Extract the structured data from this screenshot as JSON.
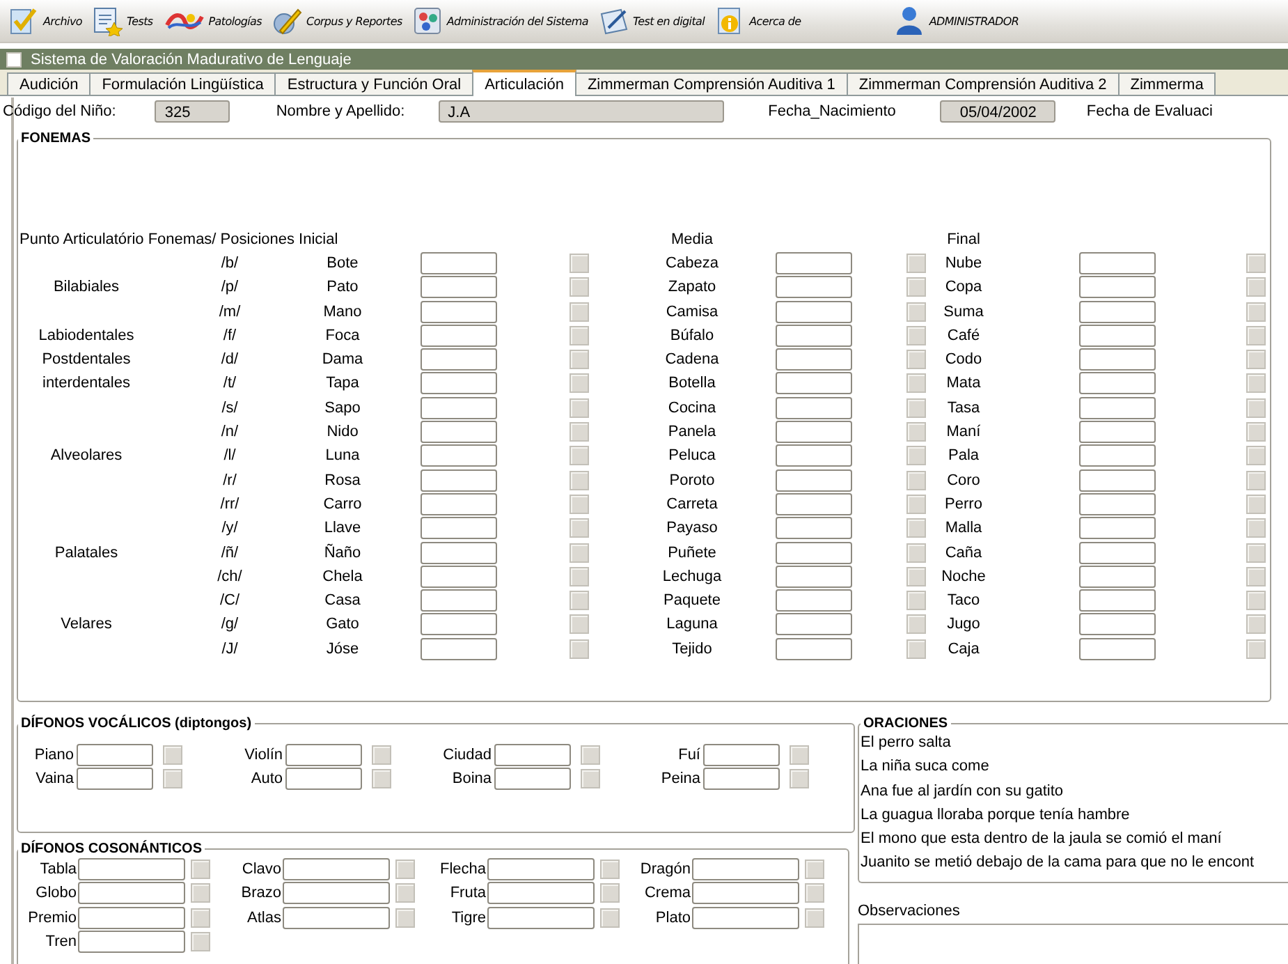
{
  "toolbar": [
    {
      "label": "Archivo",
      "kind": "check"
    },
    {
      "label": "Tests",
      "kind": "doc"
    },
    {
      "label": "Patologías",
      "kind": "paint"
    },
    {
      "label": "Corpus y Reportes",
      "kind": "pencil"
    },
    {
      "label": "Administración del Sistema",
      "kind": "admin"
    },
    {
      "label": "Test en digital",
      "kind": "digital"
    },
    {
      "label": "Acerca de",
      "kind": "info"
    },
    {
      "label": "ADMINISTRADOR",
      "kind": "user"
    }
  ],
  "window": {
    "title": "Sistema de  Valoración Madurativo de Lenguaje"
  },
  "tabs": [
    {
      "label": "Audición",
      "selected": false
    },
    {
      "label": "Formulación Lingüística",
      "selected": false
    },
    {
      "label": "Estructura y Función Oral",
      "selected": false
    },
    {
      "label": "Articulación",
      "selected": true
    },
    {
      "label": "Zimmerman Comprensión Auditiva 1",
      "selected": false
    },
    {
      "label": "Zimmerman Comprensión Auditiva 2",
      "selected": false
    },
    {
      "label": "Zimmerma",
      "selected": false
    }
  ],
  "info": [
    {
      "label": "Código del Niño:",
      "value": "325"
    },
    {
      "label": "Nombre y Apellido:",
      "value": "J.A"
    },
    {
      "label": "Fecha_Nacimiento",
      "value": "05/04/2002"
    },
    {
      "label": "Fecha de Evaluaci"
    }
  ],
  "fonemas": {
    "title": "FONEMAS",
    "header": "Punto Articulatório Fonemas/ Posiciones Inicial",
    "media_header": "Media",
    "final_header": "Final",
    "rows": [
      {
        "fonema": "/b/",
        "inicial": {
          "word": "Bote",
          "checked": false
        },
        "media": {
          "word": "Cabeza",
          "checked": false
        },
        "final": {
          "word": "Nube",
          "checked": false
        }
      },
      {
        "punto": "Bilabiales",
        "fonema": "/p/",
        "inicial": {
          "word": "Pato",
          "checked": false
        },
        "media": {
          "word": "Zapato",
          "checked": false
        },
        "final": {
          "word": "Copa",
          "checked": false
        }
      },
      {
        "fonema": "/m/",
        "inicial": {
          "word": "Mano",
          "checked": false
        },
        "media": {
          "word": "Camisa",
          "checked": false
        },
        "final": {
          "word": "Suma",
          "checked": false
        }
      },
      {
        "punto": "Labiodentales",
        "fonema": "/f/",
        "inicial": {
          "word": "Foca",
          "checked": false
        },
        "media": {
          "word": "Búfalo",
          "checked": false
        },
        "final": {
          "word": "Café",
          "checked": false
        }
      },
      {
        "punto": "Postdentales",
        "fonema": "/d/",
        "inicial": {
          "word": "Dama",
          "checked": false
        },
        "media": {
          "word": "Cadena",
          "checked": false
        },
        "final": {
          "word": "Codo",
          "checked": false
        }
      },
      {
        "punto": "interdentales",
        "fonema": "/t/",
        "inicial": {
          "word": "Tapa",
          "checked": false
        },
        "media": {
          "word": "Botella",
          "checked": false
        },
        "final": {
          "word": "Mata",
          "checked": false
        }
      },
      {
        "fonema": "/s/",
        "inicial": {
          "word": "Sapo",
          "checked": false
        },
        "media": {
          "word": "Cocina",
          "checked": false
        },
        "final": {
          "word": "Tasa",
          "checked": false
        }
      },
      {
        "fonema": "/n/",
        "inicial": {
          "word": "Nido",
          "checked": false
        },
        "media": {
          "word": "Panela",
          "checked": false
        },
        "final": {
          "word": "Maní",
          "checked": false
        }
      },
      {
        "punto": "Alveolares",
        "fonema": "/l/",
        "inicial": {
          "word": "Luna",
          "checked": false
        },
        "media": {
          "word": "Peluca",
          "checked": false
        },
        "final": {
          "word": "Pala",
          "checked": false
        }
      },
      {
        "fonema": "/r/",
        "inicial": {
          "word": "Rosa",
          "checked": false
        },
        "media": {
          "word": "Poroto",
          "checked": false
        },
        "final": {
          "word": "Coro",
          "checked": false
        }
      },
      {
        "fonema": "/rr/",
        "inicial": {
          "word": "Carro",
          "checked": false
        },
        "media": {
          "word": "Carreta",
          "checked": false
        },
        "final": {
          "word": "Perro",
          "checked": false
        }
      },
      {
        "fonema": "/y/",
        "inicial": {
          "word": "Llave",
          "checked": false
        },
        "media": {
          "word": "Payaso",
          "checked": false
        },
        "final": {
          "word": "Malla",
          "checked": false
        }
      },
      {
        "punto": "Palatales",
        "fonema": "/ñ/",
        "inicial": {
          "word": "Ñaño",
          "checked": false
        },
        "media": {
          "word": "Puñete",
          "checked": false
        },
        "final": {
          "word": "Caña",
          "checked": false
        }
      },
      {
        "fonema": "/ch/",
        "inicial": {
          "word": "Chela",
          "checked": false
        },
        "media": {
          "word": "Lechuga",
          "checked": false
        },
        "final": {
          "word": "Noche",
          "checked": false
        }
      },
      {
        "fonema": "/C/",
        "inicial": {
          "word": "Casa",
          "checked": false
        },
        "media": {
          "word": "Paquete",
          "checked": false
        },
        "final": {
          "word": "Taco",
          "checked": false
        }
      },
      {
        "punto": "Velares",
        "fonema": "/g/",
        "inicial": {
          "word": "Gato",
          "checked": false
        },
        "media": {
          "word": "Laguna",
          "checked": false
        },
        "final": {
          "word": "Jugo",
          "checked": false
        }
      },
      {
        "fonema": "/J/",
        "inicial": {
          "word": "Jóse",
          "checked": false
        },
        "media": {
          "word": "Tejido",
          "checked": false
        },
        "final": {
          "word": "Caja",
          "checked": false
        }
      }
    ]
  },
  "difonos_vocalicos": {
    "title": "DÍFONOS VOCÁLICOS (diptongos)",
    "items": [
      {
        "word": "Piano",
        "checked": false
      },
      {
        "word": "Violín",
        "checked": false
      },
      {
        "word": "Ciudad",
        "checked": false
      },
      {
        "word": "Fuí",
        "checked": false
      },
      {
        "word": "Vaina",
        "checked": false
      },
      {
        "word": "Auto",
        "checked": false
      },
      {
        "word": "Boina",
        "checked": false
      },
      {
        "word": "Peina",
        "checked": false
      }
    ]
  },
  "difonos_consonanticos": {
    "title": "DÍFONOS COSONÁNTICOS",
    "items": [
      {
        "word": "Tabla",
        "checked": false
      },
      {
        "word": "Clavo",
        "checked": false
      },
      {
        "word": "Flecha",
        "checked": false
      },
      {
        "word": "Dragón",
        "checked": false
      },
      {
        "word": "Globo",
        "checked": false
      },
      {
        "word": "Brazo",
        "checked": false
      },
      {
        "word": "Fruta",
        "checked": false
      },
      {
        "word": "Crema",
        "checked": false
      },
      {
        "word": "Premio",
        "checked": false
      },
      {
        "word": "Atlas",
        "checked": false
      },
      {
        "word": "Tigre",
        "checked": false
      },
      {
        "word": "Plato",
        "checked": false
      },
      {
        "word": "Tren",
        "checked": false
      }
    ]
  },
  "oraciones": {
    "title": "ORACIONES",
    "items": [
      "El perro salta",
      "La niña suca come",
      "Ana fue al jardín con su gatito",
      "La guagua lloraba porque tenía hambre",
      "El mono que esta dentro de la jaula se comió el maní",
      "Juanito se metió debajo de la cama para que no le encont"
    ]
  },
  "observaciones": {
    "label": "Observaciones"
  }
}
